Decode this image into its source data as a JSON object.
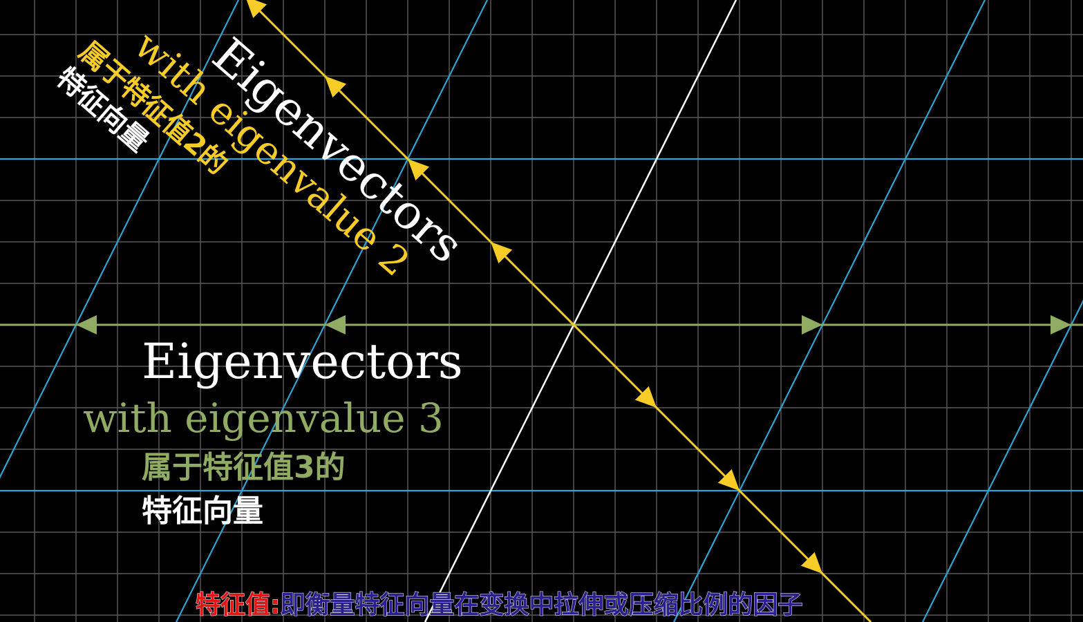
{
  "colors": {
    "background": "#000000",
    "grid": "#5a5a5a",
    "transformed_grid": "#2fa3d6",
    "eigenvalue_3": "#8fac62",
    "eigenvalue_2": "#f7cc27",
    "white_line": "#ffffff",
    "subtitle_label": "#e31414",
    "subtitle_text": "#2a1f8e"
  },
  "labels": {
    "eigenvalue_3": {
      "title": "Eigenvectors",
      "subtitle": "with eigenvalue 3",
      "cn_line1": "属于特征值3的",
      "cn_line2": "特征向量"
    },
    "eigenvalue_2": {
      "title": "Eigenvectors",
      "subtitle": "with eigenvalue 2",
      "cn_line1": "属于特征值2的",
      "cn_line2": "特征向量"
    }
  },
  "subtitle": {
    "label": "特征值:",
    "text": "即衡量特征向量在变换中拉伸或压缩比例的因子"
  },
  "icons": {
    "eigenvalue_3_arrows": "triangle-arrow-icon",
    "eigenvalue_2_arrows": "triangle-arrow-icon"
  }
}
